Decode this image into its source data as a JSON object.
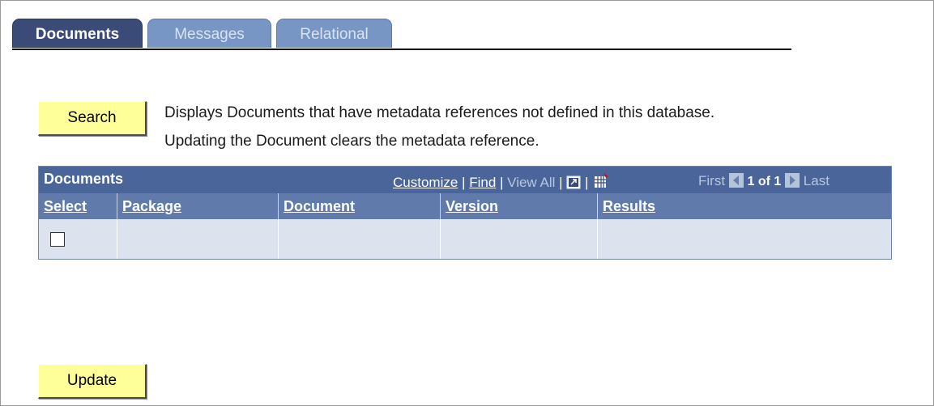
{
  "tabs": [
    {
      "label": "Documents",
      "active": true
    },
    {
      "label": "Messages",
      "active": false
    },
    {
      "label": "Relational",
      "active": false
    }
  ],
  "search": {
    "button_label": "Search",
    "description_line1": "Displays Documents that have metadata references not defined in this database.",
    "description_line2": "Updating the Document clears the metadata reference."
  },
  "grid": {
    "title": "Documents",
    "nav": {
      "customize": "Customize",
      "find": "Find",
      "view_all": "View All",
      "first": "First",
      "page_info": "1 of 1",
      "last": "Last",
      "icons": [
        "zoom-icon",
        "download-icon",
        "prev-arrow-icon",
        "next-arrow-icon"
      ]
    },
    "columns": [
      "Select",
      "Package",
      "Document",
      "Version",
      "Results"
    ],
    "rows": [
      {
        "select": false,
        "package": "",
        "document": "",
        "version": "",
        "results": ""
      }
    ]
  },
  "update": {
    "button_label": "Update"
  },
  "colors": {
    "active_tab": "#3b4b78",
    "inactive_tab": "#7796c4",
    "grid_header": "#4a6599",
    "column_header": "#5f7aab",
    "row_bg": "#dde3ee",
    "button_bg": "#ffff99"
  }
}
